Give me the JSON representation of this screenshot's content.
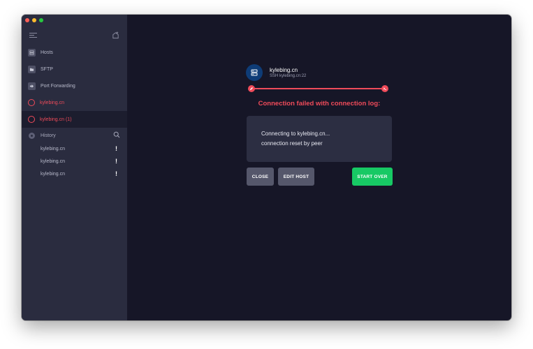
{
  "sidebar": {
    "nav": [
      {
        "label": "Hosts",
        "icon": "hosts-icon"
      },
      {
        "label": "SFTP",
        "icon": "folder-icon"
      },
      {
        "label": "Port Forwarding",
        "icon": "arrow-icon"
      }
    ],
    "sessions": [
      {
        "label": "kylebing.cn",
        "active": false
      },
      {
        "label": "kylebing.cn (1)",
        "active": true
      }
    ],
    "history": {
      "label": "History",
      "items": [
        {
          "label": "kylebing.cn",
          "badge": "!"
        },
        {
          "label": "kylebing.cn",
          "badge": "!"
        },
        {
          "label": "kylebing.cn",
          "badge": "!"
        }
      ]
    }
  },
  "connection": {
    "host_name": "kylebing.cn",
    "host_address": "SSH kylebing.cn:22",
    "error_title": "Connection failed with connection log:",
    "log_lines": [
      "Connecting to kylebing.cn...",
      "connection reset by peer"
    ]
  },
  "actions": {
    "close_label": "CLOSE",
    "edit_host_label": "EDIT HOST",
    "start_over_label": "START OVER"
  },
  "colors": {
    "error": "#f04b5a",
    "success": "#17c964",
    "sidebar_bg": "#2a2c3f",
    "main_bg": "#161627"
  }
}
